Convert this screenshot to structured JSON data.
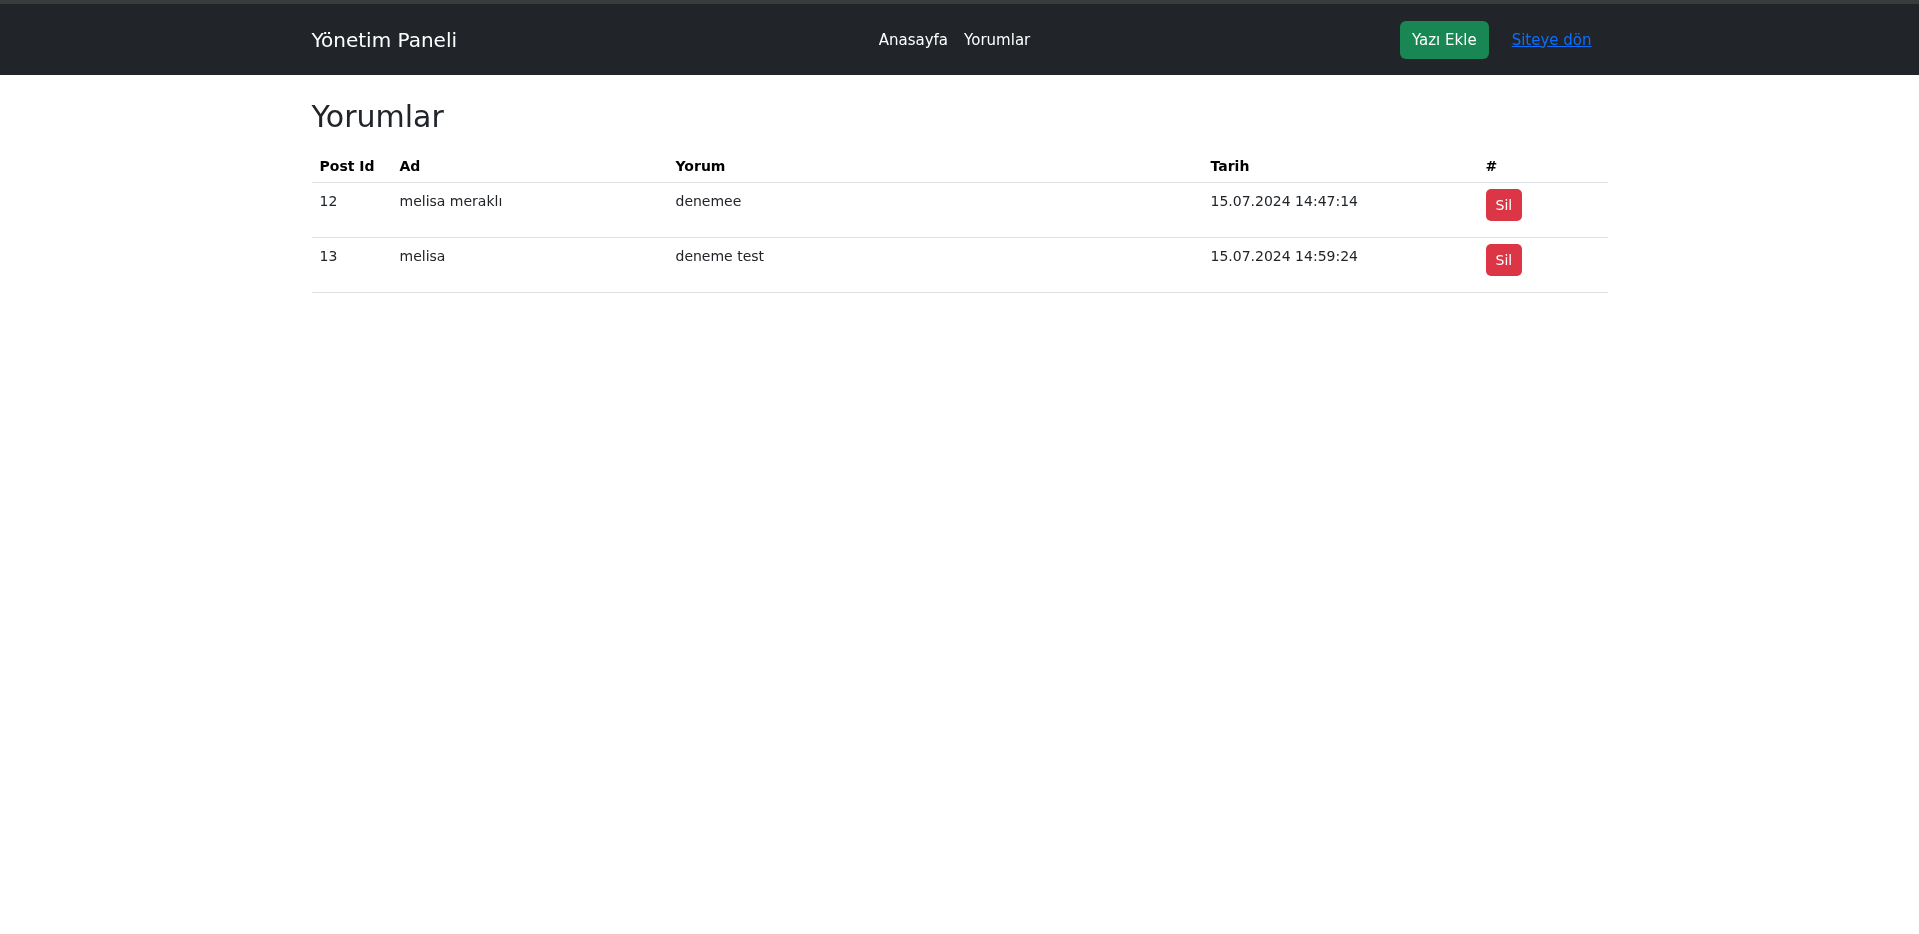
{
  "navbar": {
    "brand": "Yönetim Paneli",
    "links": [
      {
        "label": "Anasayfa"
      },
      {
        "label": "Yorumlar"
      }
    ],
    "add_button": "Yazı Ekle",
    "back_link": "Siteye dön"
  },
  "heading": "Yorumlar",
  "table": {
    "columns": [
      "Post Id",
      "Ad",
      "Yorum",
      "Tarih",
      "#"
    ],
    "rows": [
      {
        "post_id": "12",
        "name": "melisa meraklı",
        "comment": "denemee",
        "date": "15.07.2024 14:47:14",
        "action": "Sil"
      },
      {
        "post_id": "13",
        "name": "melisa",
        "comment": "deneme test",
        "date": "15.07.2024 14:59:24",
        "action": "Sil"
      }
    ]
  }
}
